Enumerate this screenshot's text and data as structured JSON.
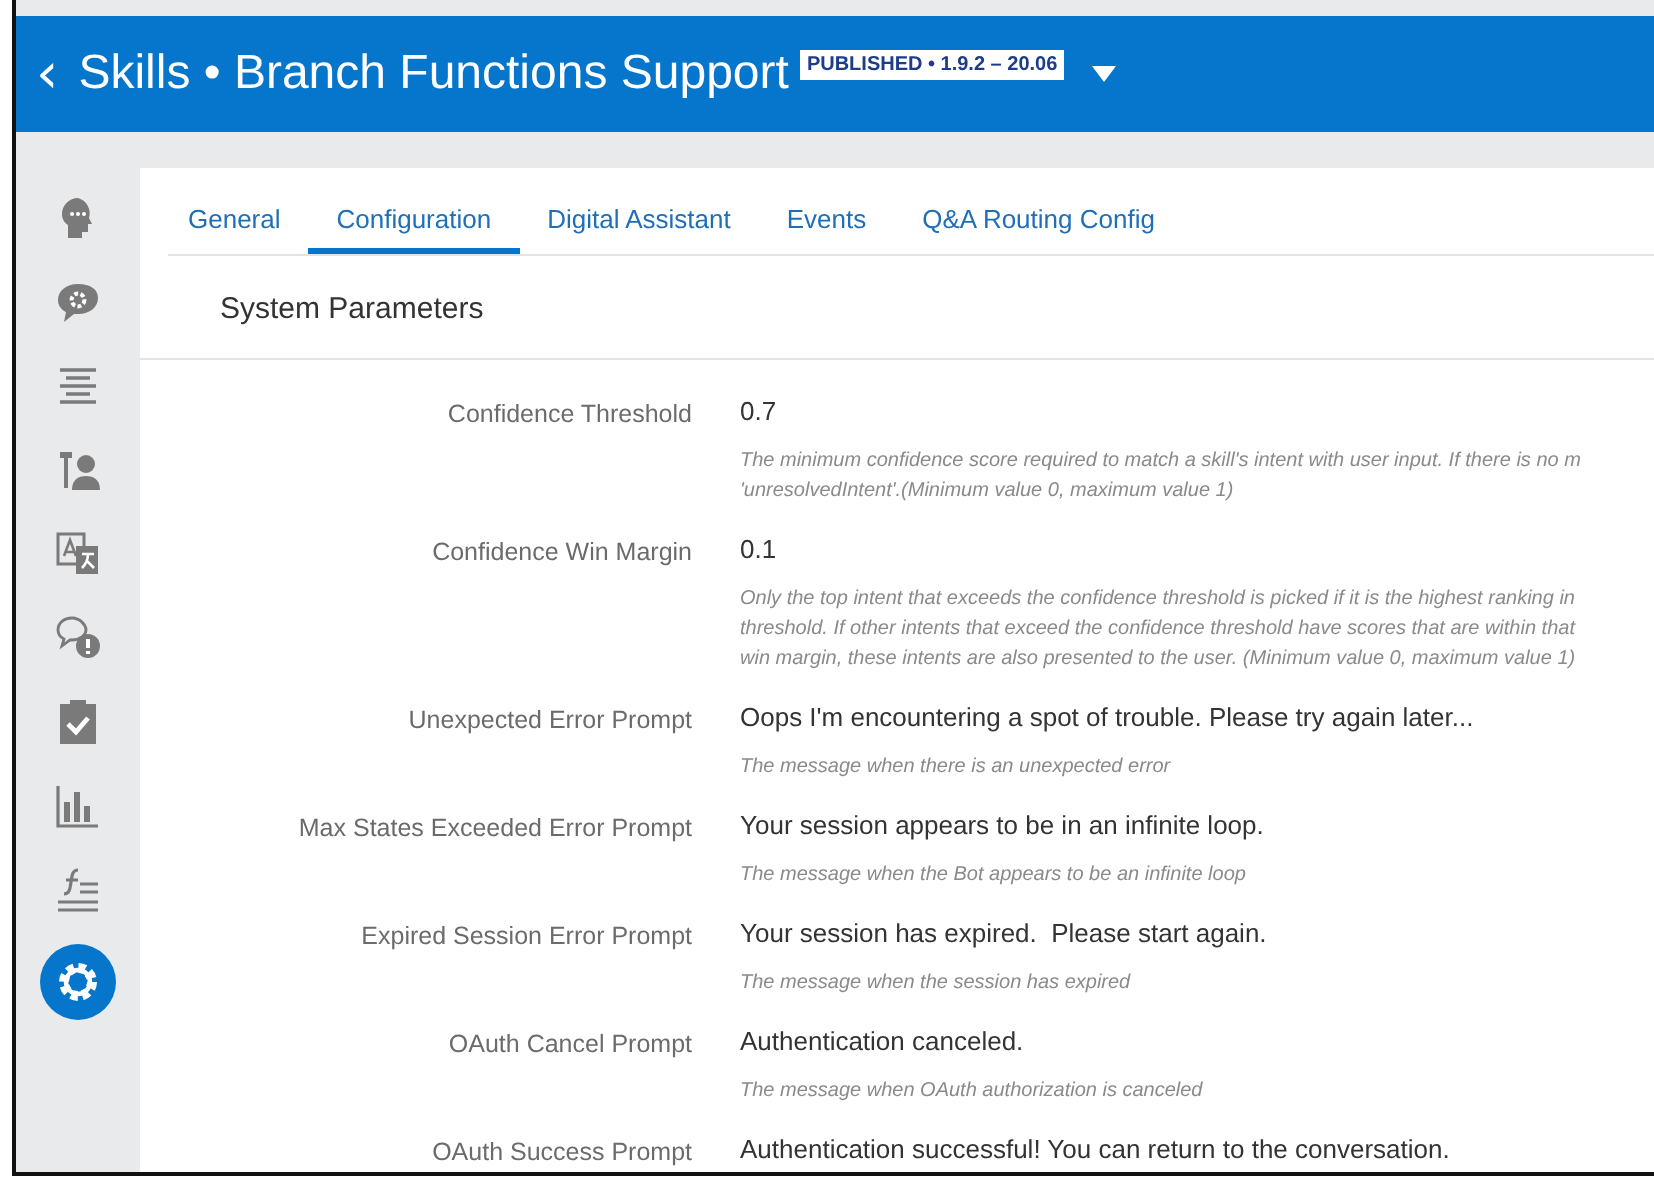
{
  "header": {
    "back": "‹",
    "title": "Skills • Branch Functions Support",
    "badge": "PUBLISHED • 1.9.2 – 20.06"
  },
  "sidebar": {
    "items": [
      {
        "kind": "head",
        "selected": false
      },
      {
        "kind": "chat-gear",
        "selected": false
      },
      {
        "kind": "lines",
        "selected": false
      },
      {
        "kind": "tools",
        "selected": false
      },
      {
        "kind": "translate",
        "selected": false
      },
      {
        "kind": "question",
        "selected": false
      },
      {
        "kind": "clipboard",
        "selected": false
      },
      {
        "kind": "chart",
        "selected": false
      },
      {
        "kind": "function",
        "selected": false
      },
      {
        "kind": "gear",
        "selected": true
      }
    ]
  },
  "tabs": [
    {
      "label": "General",
      "selected": false
    },
    {
      "label": "Configuration",
      "selected": true
    },
    {
      "label": "Digital Assistant",
      "selected": false
    },
    {
      "label": "Events",
      "selected": false
    },
    {
      "label": "Q&A Routing Config",
      "selected": false
    }
  ],
  "section_title": "System Parameters",
  "parameters": [
    {
      "label": "Confidence Threshold",
      "value": "0.7",
      "help": [
        "The minimum confidence score required to match a skill's intent with user input. If there is no m",
        "'unresolvedIntent'.(Minimum value 0, maximum value 1)"
      ]
    },
    {
      "label": "Confidence Win Margin",
      "value": "0.1",
      "help": [
        "Only the top intent that exceeds the confidence threshold is picked if it is the highest ranking in",
        "threshold. If other intents that exceed the confidence threshold have scores that are within that",
        "win margin, these intents are also presented to the user. (Minimum value 0, maximum value 1)"
      ]
    },
    {
      "label": "Unexpected Error Prompt",
      "value": "Oops I'm encountering a spot of trouble. Please try again later...",
      "help": [
        "The message when there is an unexpected error"
      ]
    },
    {
      "label": "Max States Exceeded Error Prompt",
      "value": "Your session appears to be in an infinite loop.",
      "help": [
        "The message when the Bot appears to be an infinite loop"
      ]
    },
    {
      "label": "Expired Session Error Prompt",
      "value": "Your session has expired.  Please start again.",
      "help": [
        "The message when the session has expired"
      ]
    },
    {
      "label": "OAuth Cancel Prompt",
      "value": "Authentication canceled.",
      "help": [
        "The message when OAuth authorization is canceled"
      ]
    },
    {
      "label": "OAuth Success Prompt",
      "value": "Authentication successful! You can return to the conversation."
    }
  ]
}
